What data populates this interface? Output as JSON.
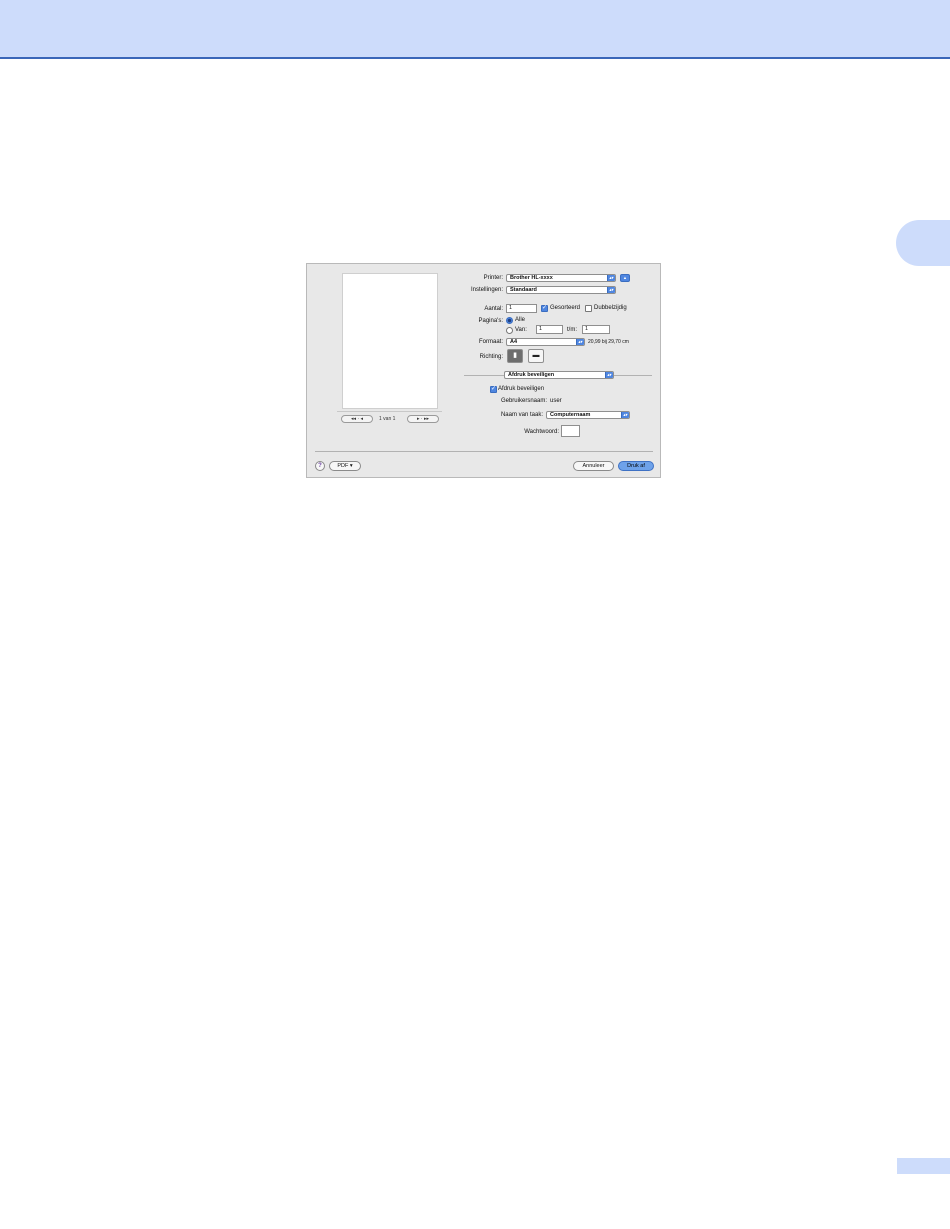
{
  "dialog": {
    "preview_nav": {
      "first_label": "◂◂ · ◂",
      "page_label": "1 van 1",
      "last_label": "▸ · ▸▸"
    },
    "printer": {
      "label": "Printer:",
      "value": "Brother HL-xxxx"
    },
    "settings": {
      "label": "Instellingen:",
      "value": "Standaard"
    },
    "copies": {
      "label": "Aantal:",
      "value": "1",
      "collated_label": "Gesorteerd",
      "collated": true,
      "duplex_label": "Dubbelzijdig",
      "duplex": false
    },
    "pages": {
      "label": "Pagina's:",
      "all_label": "Alle",
      "from_label": "Van:",
      "from_value": "1",
      "to_label": "t/m:",
      "to_value": "1"
    },
    "paper": {
      "label": "Formaat:",
      "value": "A4",
      "size_text": "20,99 bij 29,70 cm"
    },
    "orientation": {
      "label": "Richting:"
    },
    "panel": {
      "value": "Afdruk beveiligen"
    },
    "secure": {
      "checkbox_label": "Afdruk beveiligen",
      "checked": true,
      "username_label": "Gebruikersnaam:",
      "username_value": "user",
      "jobname_label": "Naam van taak:",
      "jobname_value": "Computernaam",
      "password_label": "Wachtwoord:",
      "password_value": ""
    },
    "footer": {
      "help_label": "?",
      "pdf_label": "PDF ▾",
      "cancel_label": "Annuleer",
      "print_label": "Druk af"
    }
  },
  "colors": {
    "header_band": "#cddcfb",
    "header_rule": "#3b67b9",
    "accent": "#4f86e0"
  }
}
